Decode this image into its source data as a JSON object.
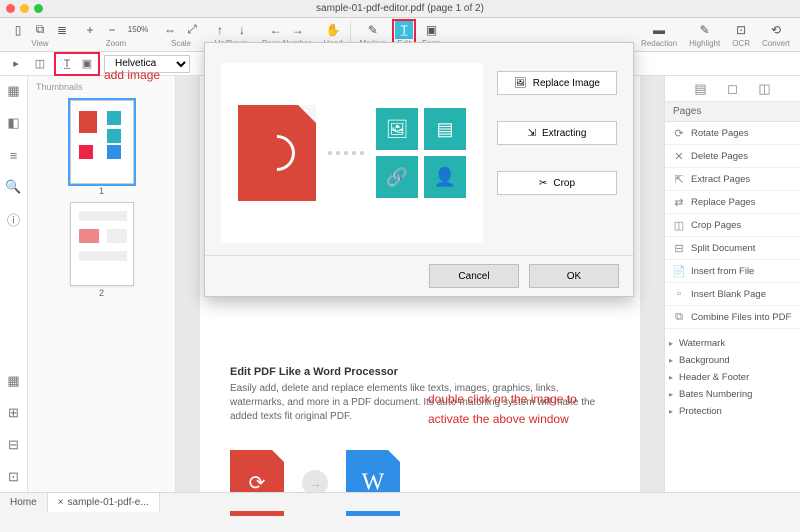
{
  "window": {
    "title": "sample-01-pdf-editor.pdf (page 1 of 2)"
  },
  "toolbar": {
    "view": "View",
    "zoom": "Zoom",
    "zoom_pct": "150%",
    "scale": "Scale",
    "updown": "Up/Down",
    "pagenum": "Page Number",
    "hand": "Hand",
    "markup": "Markup",
    "edit": "Edit",
    "form": "Form",
    "redaction": "Redaction",
    "highlight": "Highlight",
    "ocr": "OCR",
    "convert": "Convert"
  },
  "subbar": {
    "font": "Helvetica"
  },
  "thumbs": {
    "header": "Thumbnails",
    "p1": "1",
    "p2": "2"
  },
  "dialog": {
    "replace": "Replace Image",
    "extract": "Extracting",
    "crop": "Crop",
    "cancel": "Cancel",
    "ok": "OK"
  },
  "article": {
    "heading": "Edit PDF Like a Word Processor",
    "body": "Easily add, delete and replace elements like texts, images, graphics, links, watermarks, and more in a PDF document. Its auto-matching system will make the added texts fit original PDF."
  },
  "annotations": {
    "add_image": "add image",
    "dblclick1": "double click on the image to",
    "dblclick2": "activate the above window"
  },
  "right": {
    "pages_header": "Pages",
    "items": [
      "Rotate Pages",
      "Delete Pages",
      "Extract Pages",
      "Replace Pages",
      "Crop Pages",
      "Split Document",
      "Insert from File",
      "Insert Blank Page",
      "Combine Files into PDF"
    ],
    "extras": [
      "Watermark",
      "Background",
      "Header & Footer",
      "Bates Numbering",
      "Protection"
    ]
  },
  "status": {
    "home": "Home",
    "tab1": "sample-01-pdf-e..."
  }
}
